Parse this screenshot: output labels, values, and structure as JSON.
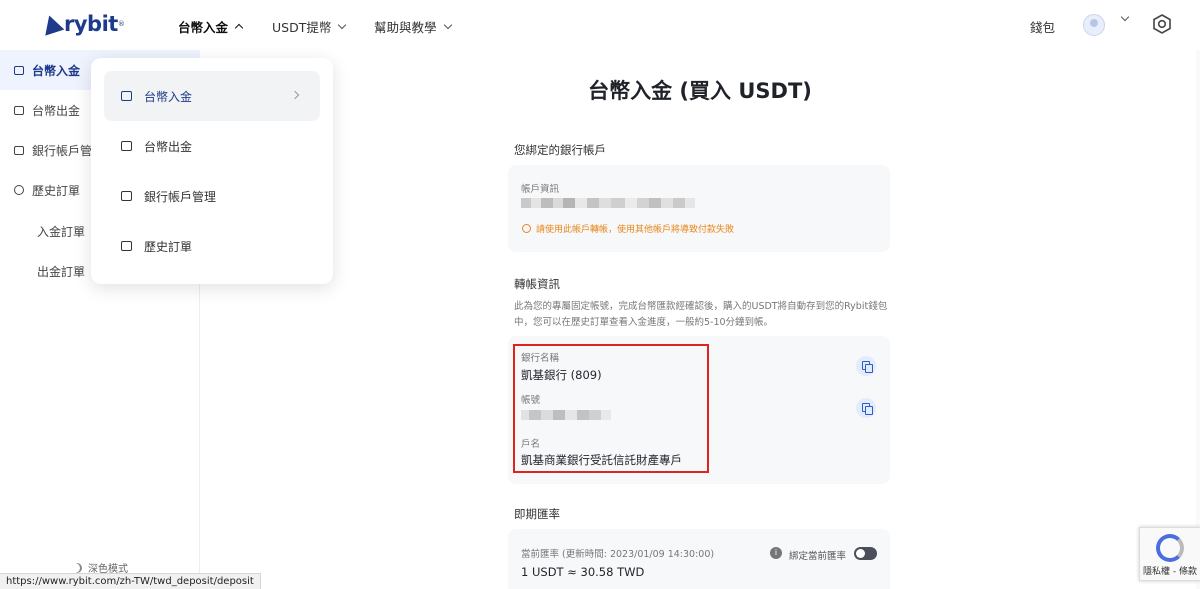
{
  "header": {
    "logo_text": "rybit",
    "logo_reg": "®",
    "nav": [
      {
        "label": "台幣入金"
      },
      {
        "label": "USDT提幣"
      },
      {
        "label": "幫助與教學"
      }
    ],
    "wallet_label": "錢包"
  },
  "sidebar": {
    "items": [
      {
        "label": "台幣入金"
      },
      {
        "label": "台幣出金"
      },
      {
        "label": "銀行帳戶管"
      },
      {
        "label": "歷史訂單"
      }
    ],
    "sub_items": [
      {
        "label": "入金訂單"
      },
      {
        "label": "出金訂單"
      }
    ],
    "dark_mode_label": "深色模式"
  },
  "dropdown": {
    "items": [
      {
        "label": "台幣入金"
      },
      {
        "label": "台幣出金"
      },
      {
        "label": "銀行帳戶管理"
      },
      {
        "label": "歷史訂單"
      }
    ]
  },
  "main": {
    "title": "台幣入金 (買入 USDT)",
    "bound_account": {
      "section_title": "您綁定的銀行帳戶",
      "field_label": "帳戶資訊",
      "warning": "請使用此帳戶轉帳，使用其他帳戶將導致付款失敗"
    },
    "transfer": {
      "section_title": "轉帳資訊",
      "description": "此為您的專屬固定帳號，完成台幣匯款經確認後，購入的USDT將自動存到您的Rybit錢包中，您可以在歷史訂單查看入金進度，一般約5-10分鐘到帳。",
      "bank_name_label": "銀行名稱",
      "bank_name_value": "凱基銀行 (809)",
      "account_no_label": "帳號",
      "account_name_label": "戶名",
      "account_name_value": "凱基商業銀行受託信託財產專戶"
    },
    "rate": {
      "section_title": "即期匯率",
      "current_label": "當前匯率 (更新時間: 2023/01/09 14:30:00)",
      "current_value": "1 USDT ≈ 30.58 TWD",
      "lock_label": "綁定當前匯率",
      "info_glyph": "i"
    }
  },
  "statusbar": {
    "url": "https://www.rybit.com/zh-TW/twd_deposit/deposit"
  },
  "recaptcha": {
    "text": "隱私權 - 條款"
  }
}
